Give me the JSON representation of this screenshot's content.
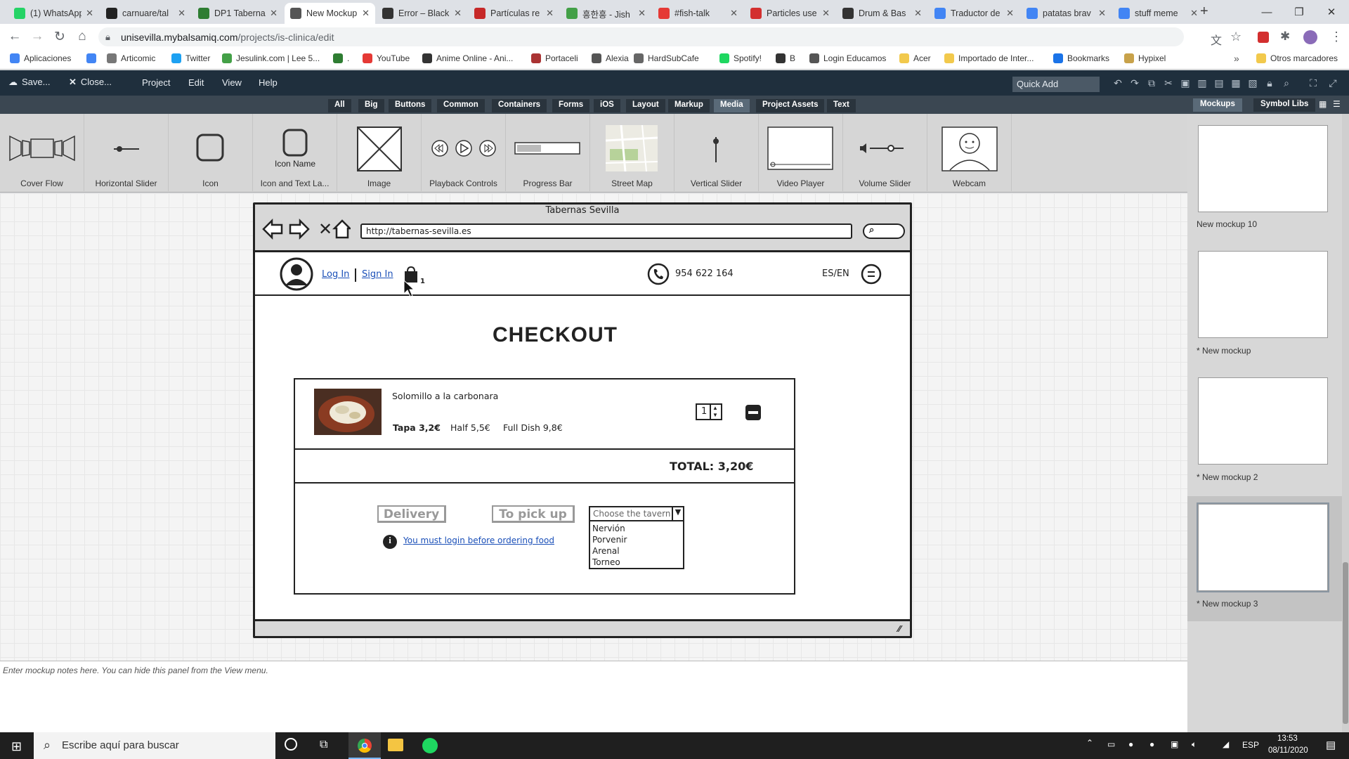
{
  "browser": {
    "tabs": [
      {
        "title": "(1) WhatsApp",
        "icon": "whatsapp-icon",
        "color": "#25d366"
      },
      {
        "title": "carnuare/tal",
        "icon": "github-icon",
        "color": "#222222"
      },
      {
        "title": "DP1 Taberna",
        "icon": "app-icon",
        "color": "#2e7d32"
      },
      {
        "title": "New Mockup",
        "icon": "balsamiq-icon",
        "color": "#555555",
        "active": true
      },
      {
        "title": "Error – Black",
        "icon": "page-icon",
        "color": "#333333"
      },
      {
        "title": "Partículas re",
        "icon": "page-icon",
        "color": "#c62828"
      },
      {
        "title": "흥한흥 - Jish",
        "icon": "page-icon",
        "color": "#43a047"
      },
      {
        "title": "#fish-talk",
        "icon": "page-icon",
        "color": "#e53935"
      },
      {
        "title": "Particles use",
        "icon": "page-icon",
        "color": "#d32f2f"
      },
      {
        "title": "Drum & Bas",
        "icon": "page-icon",
        "color": "#333333"
      },
      {
        "title": "Traductor de",
        "icon": "translate-icon",
        "color": "#4285f4"
      },
      {
        "title": "patatas brav",
        "icon": "google-icon",
        "color": "#4285f4"
      },
      {
        "title": "stuff meme",
        "icon": "google-icon",
        "color": "#4285f4"
      }
    ],
    "url_host": "unisevilla.mybalsamiq.com",
    "url_path": "/projects/is-clinica/edit",
    "bookmarks": [
      "Aplicaciones",
      "",
      "Articomic",
      "Twitter",
      "Jesulink.com | Lee 5...",
      ".",
      "YouTube",
      "Anime Online - Ani...",
      "Portaceli",
      "Alexia",
      "HardSubCafe",
      "Spotify!",
      "B",
      "Login Educamos",
      "Acer",
      "Importado de Inter...",
      "Bookmarks",
      "Hypixel"
    ],
    "other_bookmarks": "Otros marcadores"
  },
  "balsamiq": {
    "save_label": "Save...",
    "close_label": "Close...",
    "menus": [
      "Project",
      "Edit",
      "View",
      "Help"
    ],
    "quick_add_placeholder": "Quick Add",
    "categories": [
      "All",
      "Big",
      "Buttons",
      "Common",
      "Containers",
      "Forms",
      "iOS",
      "Layout",
      "Markup",
      "Media",
      "Project Assets",
      "Text"
    ],
    "selected_category": "Media",
    "components": [
      "Cover Flow",
      "Horizontal Slider",
      "Icon",
      "Icon and Text La...",
      "Image",
      "Playback Controls",
      "Progress Bar",
      "Street Map",
      "Vertical Slider",
      "Video Player",
      "Volume Slider",
      "Webcam"
    ],
    "icon_name_text": "Icon Name",
    "right_tabs": [
      "Mockups",
      "Symbol Libs"
    ],
    "mockups": [
      "New mockup 10",
      "* New mockup",
      "* New mockup 2",
      "* New mockup 3"
    ],
    "notes_placeholder": "Enter mockup notes here. You can hide this panel from the View menu."
  },
  "mockup": {
    "window_title": "Tabernas Sevilla",
    "url": "http://tabernas-sevilla.es",
    "login_link": "Log In",
    "signin_link": "Sign In",
    "cart_count": "1",
    "phone": "954 622 164",
    "language": "ES/EN",
    "page_title": "CHECKOUT",
    "item": {
      "name": "Solomillo a la carbonara",
      "tapa": "Tapa 3,2€",
      "half": "Half 5,5€",
      "full": "Full Dish 9,8€",
      "quantity": "1"
    },
    "total": "TOTAL: 3,20€",
    "delivery_button": "Delivery",
    "pickup_button": "To pick up",
    "tavern_select": "Choose the tavern",
    "taverns": [
      "Nervión",
      "Porvenir",
      "Arenal",
      "Torneo"
    ],
    "login_warning": "You must login before ordering food"
  },
  "taskbar": {
    "search_placeholder": "Escribe aquí para buscar",
    "language": "ESP",
    "time": "13:53",
    "date": "08/11/2020"
  }
}
